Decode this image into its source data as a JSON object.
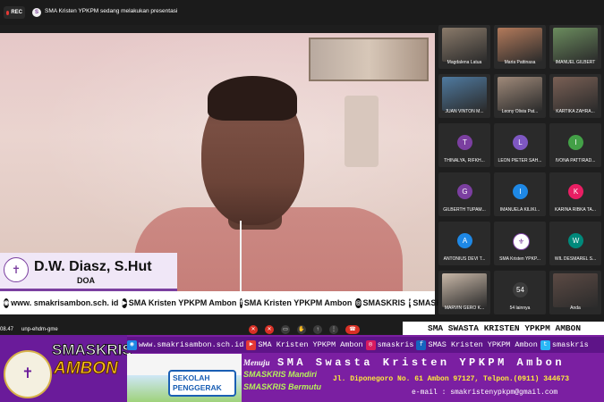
{
  "topbar": {
    "rec_label": "REC",
    "presenter_text": "SMA Kristen YPKPM sedang melakukan presentasi"
  },
  "main_video": {
    "speaker_name": "D.W. Diasz, S.Hut",
    "speaker_role": "DOA"
  },
  "social_strip": {
    "items": [
      {
        "icon": "globe-icon",
        "text": "www. smakrisambon.sch. id"
      },
      {
        "icon": "youtube-icon",
        "text": "SMA Kristen YPKPM Ambon"
      },
      {
        "icon": "facebook-icon",
        "text": "SMA Kristen YPKPM Ambon"
      },
      {
        "icon": "instagram-icon",
        "text": "SMASKRIS"
      },
      {
        "icon": "twitter-icon",
        "text": "SMASKRIS"
      }
    ]
  },
  "participants": [
    {
      "name": "Magdalena Latua",
      "type": "video",
      "color": "#8a7a6a"
    },
    {
      "name": "Maria Pattinasa",
      "type": "video",
      "color": "#b37a5b"
    },
    {
      "name": "IMANUEL GILBERT",
      "type": "video",
      "color": "#6b8c5e"
    },
    {
      "name": "JUAN VINTON M...",
      "type": "video",
      "color": "#4f7aa0"
    },
    {
      "name": "Leony Olivia Pat...",
      "type": "video",
      "color": "#a08a7a"
    },
    {
      "name": "KARTIKA ZAHRA...",
      "type": "video",
      "color": "#7a6055"
    },
    {
      "name": "THINALYA, RIFKH...",
      "type": "avatar",
      "initial": "T",
      "color": "#7b3fa0"
    },
    {
      "name": "LEON PIETER SAH...",
      "type": "avatar",
      "initial": "L",
      "color": "#7e57c2"
    },
    {
      "name": "IVONA PATTIRAD...",
      "type": "avatar",
      "initial": "I",
      "color": "#43a047"
    },
    {
      "name": "GILBERTH TUPAM...",
      "type": "avatar",
      "initial": "G",
      "color": "#7b3fa0"
    },
    {
      "name": "IMANUELA KILIKI...",
      "type": "avatar",
      "initial": "I",
      "color": "#1e88e5"
    },
    {
      "name": "KARINA RIBKA TA...",
      "type": "avatar",
      "initial": "K",
      "color": "#e91e63"
    },
    {
      "name": "ANTONIUS DEVI T...",
      "type": "avatar",
      "initial": "A",
      "color": "#1e88e5"
    },
    {
      "name": "SMA Kristen YPKP...",
      "type": "logo",
      "initial": "⚜",
      "color": "#ffffff"
    },
    {
      "name": "WIL DESMAREL S...",
      "type": "avatar",
      "initial": "W",
      "color": "#00897b"
    },
    {
      "name": "MARVIN GERO K...",
      "type": "video",
      "color": "#c9b8a8"
    },
    {
      "name": "54 lainnya",
      "type": "more",
      "initial": "54",
      "color": "#3c3c3c"
    },
    {
      "name": "Anda",
      "type": "video",
      "color": "#5c4a44"
    }
  ],
  "meeting_bar": {
    "time": "08.47",
    "meeting_code": "unp-ehdm-gme"
  },
  "school": {
    "top_label": "SMA SWASTA KRISTEN YPKPM AMBON",
    "name_line1": "SMASKRIS",
    "name_line2": "AMBON",
    "links": [
      {
        "icon": "globe-icon",
        "text": "www.smakrisambon.sch.id",
        "color": "#1e88e5"
      },
      {
        "icon": "youtube-icon",
        "text": "SMA Kristen YPKPM Ambon",
        "color": "#e53935"
      },
      {
        "icon": "instagram-icon",
        "text": "smaskris",
        "color": "#d81b60"
      },
      {
        "icon": "facebook-icon",
        "text": "SMAS Kristen YPKPM Ambon",
        "color": "#1565c0"
      },
      {
        "icon": "twitter-icon",
        "text": "smaskris",
        "color": "#29b6f6"
      }
    ],
    "sekolah_line1": "SEKOLAH",
    "sekolah_line2": "PENGGERAK",
    "menuju": "Menuju",
    "full_name": "SMA Swasta Kristen YPKPM Ambon",
    "mandiri": "SMASKRIS Mandiri",
    "bermutu": "SMASKRIS Bermutu",
    "address": "Jl. Diponegoro  No. 61 Ambon 97127, Telpon.(0911) 344673",
    "email": "e-mail : smakristenypkpm@gmail.com"
  }
}
